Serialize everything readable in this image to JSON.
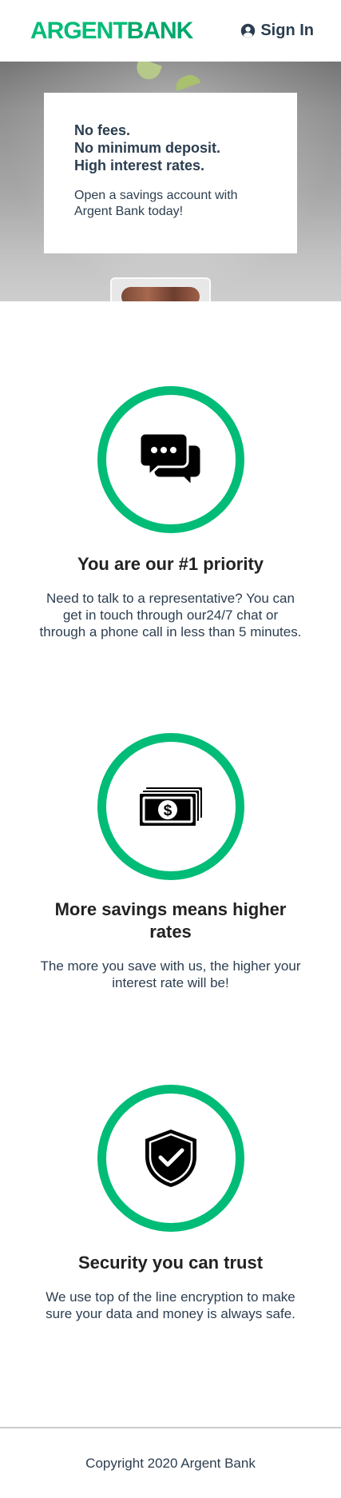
{
  "nav": {
    "logo_part1": "ARGENT",
    "logo_part2": "BANK",
    "signin_label": "Sign In",
    "user_icon": "user-circle-icon"
  },
  "hero": {
    "subtitles": [
      "No fees.",
      "No minimum deposit.",
      "High interest rates."
    ],
    "text": "Open a savings account with Argent Bank today!"
  },
  "features": [
    {
      "icon": "chat-icon",
      "title": "You are our #1 priority",
      "text": "Need to talk to a representative? You can get in touch through our24/7 chat or through a phone call in less than 5 minutes."
    },
    {
      "icon": "money-icon",
      "title": "More savings means higher rates",
      "text": "The more you save with us, the higher your interest rate will be!"
    },
    {
      "icon": "security-icon",
      "title": "Security you can trust",
      "text": "We use top of the line encryption to make sure your data and money is always safe."
    }
  ],
  "footer": {
    "copyright": "Copyright 2020 Argent Bank"
  },
  "colors": {
    "accent": "#00bc77",
    "text": "#2c3e50"
  }
}
